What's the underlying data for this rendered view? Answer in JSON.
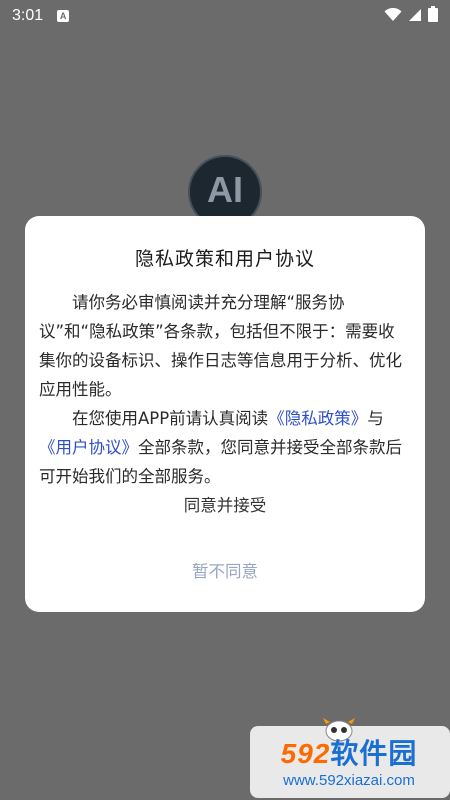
{
  "status_bar": {
    "time": "3:01",
    "notification_icon_label": "A",
    "icons": [
      "notification-icon",
      "wifi-icon",
      "signal-icon",
      "battery-icon"
    ]
  },
  "app": {
    "logo_text": "AI"
  },
  "dialog": {
    "title": "隐私政策和用户协议",
    "paragraph1": "请你务必审慎阅读并充分理解“服务协议”和“隐私政策”各条款，包括但不限于：需要收集你的设备标识、操作日志等信息用于分析、优化应用性能。",
    "paragraph2_prefix": "在您使用APP前请认真阅读",
    "privacy_link": "《隐私政策》",
    "paragraph2_mid": "与",
    "user_agreement_link": "《用户协议》",
    "paragraph2_suffix": "全部条款，您同意并接受全部条款后可开始我们的全部服务。",
    "accept_label": "同意并接受",
    "decline_label": "暂不同意"
  },
  "watermark": {
    "brand_number": "592",
    "brand_text": "软件园",
    "url": "www.592xiazai.com"
  },
  "colors": {
    "background": "#6b6b6b",
    "link": "#2f4fc6",
    "decline": "#9aa4c4"
  }
}
